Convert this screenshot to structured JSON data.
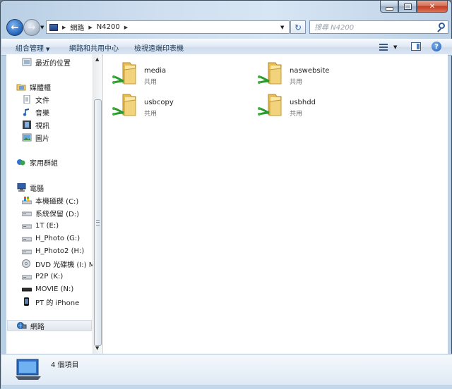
{
  "window": {
    "caption_buttons": {
      "minimize_icon": "minimize-icon",
      "maximize_icon": "maximize-icon",
      "close_glyph": "✕"
    }
  },
  "nav": {
    "back_glyph": "←",
    "forward_glyph": "→",
    "address": {
      "root_icon": "network-computer-icon",
      "breadcrumbs": [
        "網路",
        "N4200"
      ]
    },
    "refresh_glyph": "↻",
    "search_placeholder": "搜尋 N4200"
  },
  "commandbar": {
    "organize": "組合管理",
    "network_center": "網路和共用中心",
    "view_printers": "檢視遠端印表機"
  },
  "sidebar": {
    "recent": "最近的位置",
    "libraries": "媒體櫃",
    "library_items": [
      "文件",
      "音樂",
      "視訊",
      "圖片"
    ],
    "homegroup": "家用群組",
    "computer": "電腦",
    "drives": [
      {
        "label": "本機磁碟 (C:)",
        "icon": "hard-drive-windows-icon"
      },
      {
        "label": "系統保留 (D:)",
        "icon": "hard-drive-icon"
      },
      {
        "label": "1T (E:)",
        "icon": "hard-drive-icon"
      },
      {
        "label": "H_Photo (G:)",
        "icon": "hard-drive-icon"
      },
      {
        "label": "H_Photo2 (H:)",
        "icon": "hard-drive-icon"
      },
      {
        "label": "DVD 光碟機 (I:) MX",
        "icon": "dvd-drive-icon"
      },
      {
        "label": "P2P (K:)",
        "icon": "hard-drive-icon"
      },
      {
        "label": "MOVIE (N:)",
        "icon": "removable-drive-icon"
      },
      {
        "label": "PT 的 iPhone",
        "icon": "iphone-icon"
      }
    ],
    "network": "網路"
  },
  "content": {
    "shares": [
      {
        "name": "media",
        "type": "共用"
      },
      {
        "name": "naswebsite",
        "type": "共用"
      },
      {
        "name": "usbcopy",
        "type": "共用"
      },
      {
        "name": "usbhdd",
        "type": "共用"
      }
    ]
  },
  "details": {
    "item_count": "4 個項目"
  },
  "colors": {
    "folder": "#f2d27a",
    "share_pipe": "#2a9a2a",
    "accent": "#2563b8"
  }
}
